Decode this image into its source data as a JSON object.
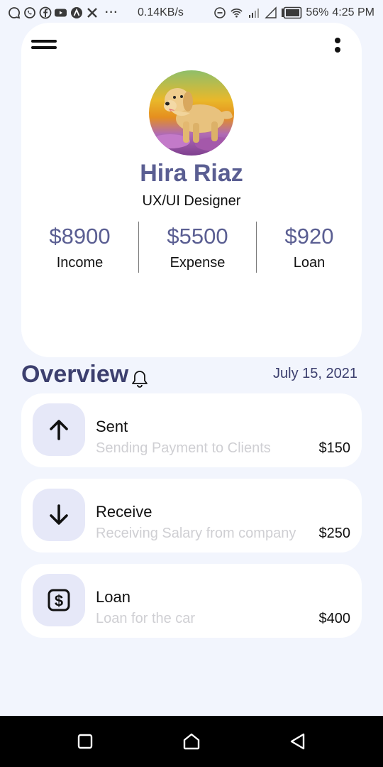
{
  "status_bar": {
    "more": "···",
    "speed": "0.14KB/s",
    "battery": "56%",
    "time": "4:25 PM"
  },
  "profile": {
    "name": "Hira Riaz",
    "role": "UX/UI Designer",
    "avatar_icon": "dog-photo",
    "stats": [
      {
        "value": "$8900",
        "label": "Income"
      },
      {
        "value": "$5500",
        "label": "Expense"
      },
      {
        "value": "$920",
        "label": "Loan"
      }
    ]
  },
  "overview": {
    "title": "Overview",
    "date": "July 15, 2021",
    "transactions": [
      {
        "icon": "arrow-up-icon",
        "title": "Sent",
        "subtitle": "Sending Payment to Clients",
        "amount": "$150"
      },
      {
        "icon": "arrow-down-icon",
        "title": "Receive",
        "subtitle": "Receiving Salary from company",
        "amount": "$250"
      },
      {
        "icon": "dollar-icon",
        "title": "Loan",
        "subtitle": "Loan for the car",
        "amount": "$400"
      }
    ]
  },
  "colors": {
    "background": "#f2f5fd",
    "accent": "#5a5e92",
    "heading": "#3c3f6e",
    "icon_bg": "#e6e8f8",
    "muted_text": "#cfcfd3"
  }
}
